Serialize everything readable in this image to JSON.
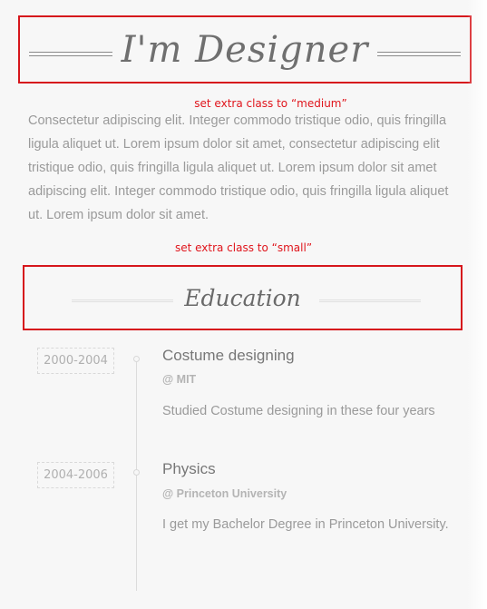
{
  "heading_main": "I'm Designer",
  "note_medium": "set extra class to “medium”",
  "intro_text": "Consectetur adipiscing elit. Integer commodo tristique odio, quis fringilla ligula aliquet ut. Lorem ipsum dolor sit amet, consectetur adipiscing elit tristique odio, quis fringilla ligula aliquet ut. Lorem ipsum dolor sit amet adipiscing elit. Integer commodo tristique odio, quis fringilla ligula aliquet ut. Lorem ipsum dolor sit amet.",
  "note_small": "set extra class to “small”",
  "section_heading": "Education",
  "timeline": [
    {
      "date": "2000-2004",
      "title": "Costume designing",
      "institution": "@ MIT",
      "description": "Studied Costume designing in these four years"
    },
    {
      "date": "2004-2006",
      "title": "Physics",
      "institution": "@ Princeton University",
      "description": "I get my Bachelor Degree in Princeton University."
    }
  ],
  "colors": {
    "annotation_red": "#d6161c",
    "text_gray": "#9a9a9a",
    "heading_gray": "#6f6f6f",
    "background": "#f7f7f7"
  }
}
